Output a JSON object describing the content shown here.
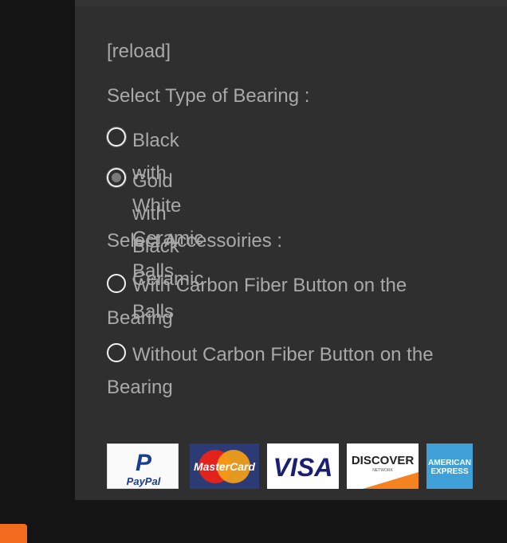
{
  "reload_link": "[reload]",
  "bearing": {
    "heading": "Select Type of Bearing :",
    "options": [
      {
        "label": "Black with White Ceramic Balls",
        "checked": false
      },
      {
        "label": "Gold with Black Ceramic Balls",
        "checked": true
      }
    ]
  },
  "accessories": {
    "heading": "Select Accessoiries :",
    "options": [
      {
        "label": "With Carbon Fiber Button on the Bearing",
        "checked": false
      },
      {
        "label": "Without Carbon Fiber Button on the Bearing",
        "checked": false
      }
    ]
  },
  "payment_logos": {
    "paypal": {
      "line1": "P",
      "line2": "PayPal"
    },
    "mastercard": "MasterCard",
    "visa": "VISA",
    "discover": {
      "line1": "DISCOVER",
      "line2": "NETWORK"
    },
    "amex": {
      "line1": "AMERICAN",
      "line2": "EXPRESS"
    }
  },
  "colors": {
    "page_background": "#141414",
    "panel_background": "#2f2f2f",
    "text": "#a9a9a9",
    "radio_ring": "#f2f2f2",
    "feedback_tab": "#f26c1f"
  }
}
